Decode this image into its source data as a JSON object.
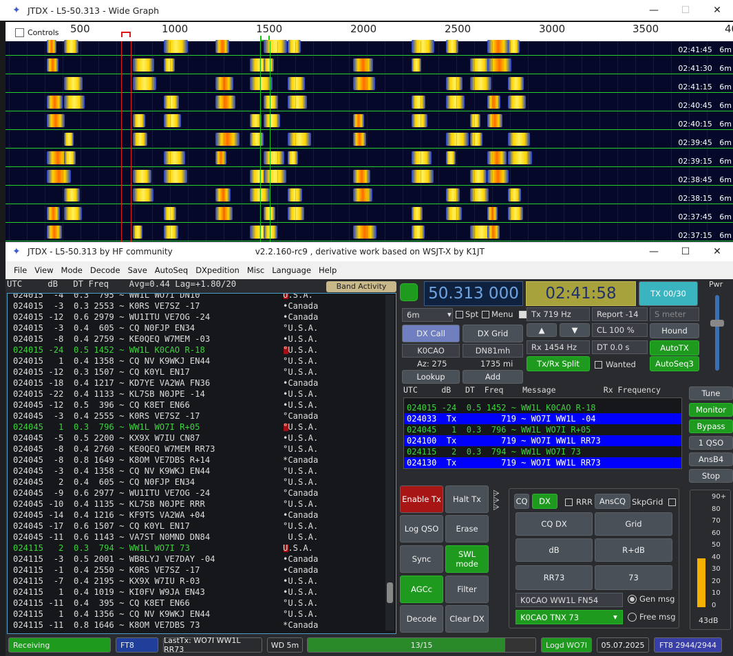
{
  "wide_graph": {
    "title": "JTDX - L5-50.313 - Wide Graph",
    "controls_label": "Controls",
    "ticks": [
      "500",
      "1000",
      "1500",
      "2000",
      "2500",
      "3000",
      "3500",
      "40"
    ],
    "time_labels": [
      "02:41:45",
      "02:41:30",
      "02:41:15",
      "02:40:45",
      "02:40:15",
      "02:39:45",
      "02:39:15",
      "02:38:45",
      "02:38:15",
      "02:37:45",
      "02:37:15"
    ],
    "band_labels": [
      "6m",
      "6m",
      "6m",
      "6m",
      "6m",
      "6m",
      "6m",
      "6m",
      "6m",
      "6m",
      "6m"
    ]
  },
  "main_window": {
    "title": "JTDX - L5-50.313  by HF community",
    "version": "v2.2.160-rc9 , derivative work based on WSJT-X by K1JT"
  },
  "menu": [
    "File",
    "View",
    "Mode",
    "Decode",
    "Save",
    "AutoSeq",
    "DXpedition",
    "Misc",
    "Language",
    "Help"
  ],
  "list_header": "UTC     dB   DT Freq    Avg=0.44 Lag=+1.80/20",
  "band_activity": "Band Activity",
  "decodes": [
    {
      "t": "024015  -4  0.3  795 ~ WW1L WO7I DN10",
      "c": "U.S.A.",
      "col": "#ddd",
      "mk": true
    },
    {
      "t": "024015  -3  0.3 2553 ~ K0RS VE7SZ -17",
      "c": "•Canada",
      "col": "#ddd"
    },
    {
      "t": "024015 -12  0.6 2979 ~ WU1ITU VE7OG -24",
      "c": "•Canada",
      "col": "#ddd"
    },
    {
      "t": "024015  -3  0.4  605 ~ CQ N0FJP EN34",
      "c": "°U.S.A.",
      "col": "#ddd"
    },
    {
      "t": "024015  -8  0.4 2759 ~ KE0QEQ W7MEM -03",
      "c": "•U.S.A.",
      "col": "#ddd"
    },
    {
      "t": "024015 -24  0.5 1452 ~ WW1L K0CAO R-18",
      "c": "°U.S.A.",
      "col": "#3ed33e",
      "mk": true
    },
    {
      "t": "024015   1  0.4 1358 ~ CQ NV K9WKJ EN44",
      "c": "°U.S.A.",
      "col": "#ddd"
    },
    {
      "t": "024015 -12  0.3 1507 ~ CQ K0YL EN17",
      "c": "°U.S.A.",
      "col": "#ddd"
    },
    {
      "t": "024015 -18  0.4 1217 ~ KD7YE VA2WA FN36",
      "c": "•Canada",
      "col": "#ddd"
    },
    {
      "t": "024015 -22  0.4 1133 ~ KL7SB N0JPE -14",
      "c": "•U.S.A.",
      "col": "#ddd"
    },
    {
      "t": "024045 -12  0.5  396 ~ CQ K8ET EN66",
      "c": "•U.S.A.",
      "col": "#ddd"
    },
    {
      "t": "024045  -3  0.4 2555 ~ K0RS VE7SZ -17",
      "c": "°Canada",
      "col": "#ddd"
    },
    {
      "t": "024045   1  0.3  796 ~ WW1L WO7I R+05",
      "c": "°U.S.A.",
      "col": "#3ed33e",
      "mk": true
    },
    {
      "t": "024045  -5  0.5 2200 ~ KX9X W7IU CN87",
      "c": "•U.S.A.",
      "col": "#ddd"
    },
    {
      "t": "024045  -8  0.4 2760 ~ KE0QEQ W7MEM RR73",
      "c": "°U.S.A.",
      "col": "#ddd"
    },
    {
      "t": "024045  -8  0.8 1649 ~ K8OM VE7DBS R+14",
      "c": "*Canada",
      "col": "#ddd"
    },
    {
      "t": "024045  -3  0.4 1358 ~ CQ NV K9WKJ EN44",
      "c": "°U.S.A.",
      "col": "#ddd"
    },
    {
      "t": "024045   2  0.4  605 ~ CQ N0FJP EN34",
      "c": "°U.S.A.",
      "col": "#ddd"
    },
    {
      "t": "024045  -9  0.6 2977 ~ WU1ITU VE7OG -24",
      "c": "°Canada",
      "col": "#ddd"
    },
    {
      "t": "024045 -10  0.4 1135 ~ KL7SB N0JPE RRR",
      "c": "°U.S.A.",
      "col": "#ddd"
    },
    {
      "t": "024045 -14  0.4 1216 ~ KF9TS VA2WA +04",
      "c": "•Canada",
      "col": "#ddd"
    },
    {
      "t": "024045 -17  0.6 1507 ~ CQ K0YL EN17",
      "c": "°U.S.A.",
      "col": "#ddd"
    },
    {
      "t": "024045 -11  0.6 1143 ~ VA7ST N0MND DN84",
      "c": " U.S.A.",
      "col": "#ddd"
    },
    {
      "t": "024115   2  0.3  794 ~ WW1L WO7I 73",
      "c": "U.S.A.",
      "col": "#3ed33e",
      "mk": true
    },
    {
      "t": "024115  -3  0.5 2001 ~ WB8LYJ VE7DAY -04",
      "c": "•Canada",
      "col": "#ddd"
    },
    {
      "t": "024115  -1  0.4 2550 ~ K0RS VE7SZ -17",
      "c": "•Canada",
      "col": "#ddd"
    },
    {
      "t": "024115  -7  0.4 2195 ~ KX9X W7IU R-03",
      "c": "•U.S.A.",
      "col": "#ddd"
    },
    {
      "t": "024115   1  0.4 1019 ~ KI0FV W9JA EN43",
      "c": "•U.S.A.",
      "col": "#ddd"
    },
    {
      "t": "024115 -11  0.4  395 ~ CQ K8ET EN66",
      "c": "°U.S.A.",
      "col": "#ddd"
    },
    {
      "t": "024115   1  0.4 1356 ~ CQ NV K9WKJ EN44",
      "c": "°U.S.A.",
      "col": "#ddd"
    },
    {
      "t": "024115 -11  0.8 1646 ~ K8OM VE7DBS 73",
      "c": "*Canada",
      "col": "#ddd"
    }
  ],
  "controls": {
    "freq": "50.313 000",
    "clock": "02:41:58",
    "tx_btn": "TX 00/30",
    "pwr": "Pwr",
    "band": "6m",
    "spt": "Spt",
    "menu": "Menu",
    "tx_hz": "Tx  719  Hz",
    "report": "Report -14",
    "smeter": "S meter",
    "dx_call_btn": "DX Call",
    "dx_grid_btn": "DX Grid",
    "dx_call": "K0CAO",
    "dx_grid": "DN81mh",
    "hound": "Hound",
    "az": "Az: 275",
    "dist": "1735 mi",
    "rx_hz": "Rx  1454  Hz",
    "cl": "CL  100 %",
    "dt": "DT 0.0 s",
    "autotx": "AutoTX",
    "lookup": "Lookup",
    "add": "Add",
    "split": "Tx/Rx Split",
    "wanted": "Wanted",
    "autoseq3": "AutoSeq3",
    "up": "▲",
    "down": "▼"
  },
  "rx_header": "UTC     dB   DT  Freq    Message          Rx Frequency",
  "rx_rows": [
    {
      "t": "024015 -24  0.5 1452 ~ WW1L K0CAO R-18",
      "k": "rx"
    },
    {
      "t": "024033  Tx         719 ~ WO7I WW1L -04",
      "k": "tx"
    },
    {
      "t": "024045   1  0.3  796 ~ WW1L WO7I R+05",
      "k": "rx"
    },
    {
      "t": "024100  Tx         719 ~ WO7I WW1L RR73",
      "k": "tx"
    },
    {
      "t": "024115   2  0.3  794 ~ WW1L WO7I 73",
      "k": "rx"
    },
    {
      "t": "024130  Tx         719 ~ WO7I WW1L RR73",
      "k": "tx"
    }
  ],
  "side_buttons": [
    "Tune",
    "Monitor",
    "Bypass",
    "1 QSO",
    "AnsB4",
    "Stop"
  ],
  "left_buttons": {
    "enable_tx": "Enable Tx",
    "halt_tx": "Halt Tx",
    "log_qso": "Log QSO",
    "erase": "Erase",
    "sync": "Sync",
    "swl": "SWL mode",
    "agcc": "AGCc",
    "filter": "Filter",
    "decode": "Decode",
    "clear_dx": "Clear DX"
  },
  "msg_panel": {
    "cq": "CQ",
    "dx": "DX",
    "rrr": "RRR",
    "anscq": "AnsCQ",
    "skpgrid": "SkpGrid",
    "cqdx": "CQ DX",
    "grid": "Grid",
    "db": "dB",
    "rdb": "R+dB",
    "rr73": "RR73",
    "s73": "73",
    "gen_text": "K0CAO WW1L FN54",
    "gen_label": "Gen msg",
    "free_text": "K0CAO TNX 73",
    "free_label": "Free msg"
  },
  "meter": {
    "ticks": [
      "90+",
      "80",
      "70",
      "60",
      "50",
      "40",
      "30",
      "20",
      "10",
      "0"
    ],
    "level_db": "43dB",
    "level_fraction": 0.42
  },
  "status": {
    "receiving": "Receiving",
    "mode": "FT8",
    "last_tx": "LastTx: WO7I WW1L RR73",
    "wd": "WD 5m",
    "progress": "13/15",
    "progress_fraction": 0.867,
    "logd": "Logd WO7I",
    "date": "05.07.2025",
    "count": "FT8  2944/2944"
  }
}
